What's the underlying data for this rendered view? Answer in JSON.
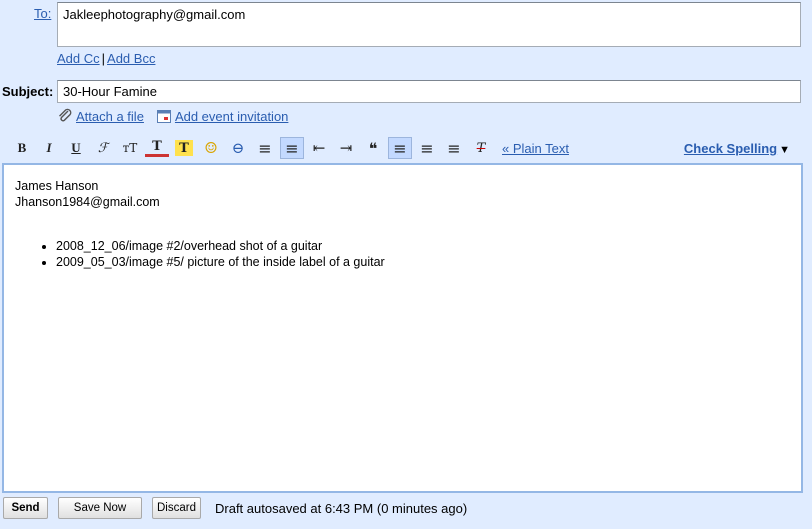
{
  "compose": {
    "to_label": "To:",
    "to_value": "Jakleephotography@gmail.com",
    "add_cc": "Add Cc",
    "cc_separator": "|",
    "add_bcc": "Add Bcc",
    "subject_label": "Subject:",
    "subject_value": "30-Hour Famine",
    "attach_file": "Attach a file",
    "add_event": "Add event invitation"
  },
  "toolbar": {
    "buttons": [
      {
        "name": "bold",
        "glyph": "B"
      },
      {
        "name": "italic",
        "glyph": "I"
      },
      {
        "name": "underline",
        "glyph": "U"
      },
      {
        "name": "font",
        "glyph": "ℱ"
      },
      {
        "name": "size",
        "glyph": "тT"
      },
      {
        "name": "text-color",
        "glyph": "T"
      },
      {
        "name": "highlight",
        "glyph": "T"
      },
      {
        "name": "emoticon",
        "glyph": "☺"
      },
      {
        "name": "link",
        "glyph": "⊖"
      },
      {
        "name": "numbered-list",
        "glyph": "≡"
      },
      {
        "name": "bulleted-list",
        "glyph": "≡"
      },
      {
        "name": "indent-less",
        "glyph": "⇤"
      },
      {
        "name": "indent-more",
        "glyph": "⇥"
      },
      {
        "name": "quote",
        "glyph": "❝"
      },
      {
        "name": "align-left",
        "glyph": "≡"
      },
      {
        "name": "align-center",
        "glyph": "≡"
      },
      {
        "name": "align-right",
        "glyph": "≡"
      },
      {
        "name": "remove-format",
        "glyph": "T"
      }
    ],
    "plain_text": "« Plain Text",
    "check_spelling": "Check Spelling",
    "check_spelling_arrow": "▼"
  },
  "body": {
    "name": "James Hanson",
    "email": "Jhanson1984@gmail.com",
    "items": [
      "2008_12_06/image #2/overhead shot of a guitar",
      "2009_05_03/image #5/ picture of the inside label of a guitar"
    ]
  },
  "footer": {
    "send": "Send",
    "save_now": "Save Now",
    "discard": "Discard",
    "status": "Draft autosaved at 6:43 PM (0 minutes ago)"
  }
}
